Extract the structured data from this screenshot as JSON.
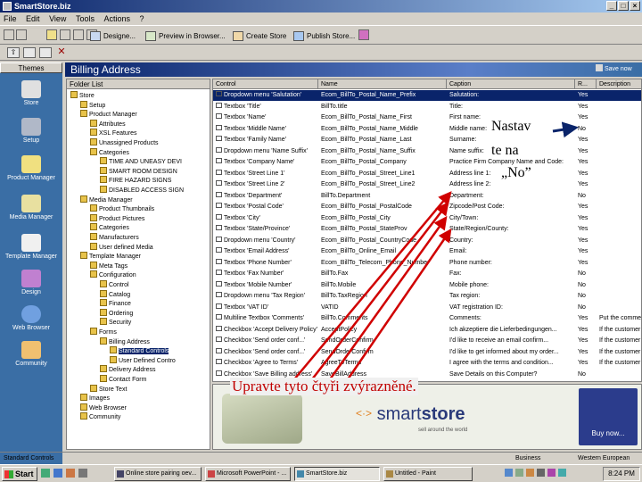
{
  "window": {
    "title": "SmartStore.biz"
  },
  "menu": [
    "File",
    "Edit",
    "View",
    "Tools",
    "Actions",
    "?"
  ],
  "toolbar": {
    "items": [
      "Designe...",
      "Preview in Browser...",
      "Create Store",
      "Publish Store..."
    ]
  },
  "themes": {
    "header": "Themes",
    "items": [
      "Store",
      "Setup",
      "Product Manager",
      "Media Manager",
      "Template Manager",
      "Design",
      "Web Browser",
      "Community"
    ]
  },
  "main": {
    "title": "Billing Address",
    "save_label": "Save now"
  },
  "folder": {
    "header": "Folder List",
    "items": [
      {
        "label": "Store",
        "level": 0
      },
      {
        "label": "Setup",
        "level": 1
      },
      {
        "label": "Product Manager",
        "level": 1
      },
      {
        "label": "Attributes",
        "level": 2
      },
      {
        "label": "XSL Features",
        "level": 2
      },
      {
        "label": "Unassigned Products",
        "level": 2
      },
      {
        "label": "Categories",
        "level": 2
      },
      {
        "label": "TIME AND UNEASY DEVI",
        "level": 3
      },
      {
        "label": "SMART ROOM DESIGN",
        "level": 3
      },
      {
        "label": "FIRE HAZARD SIGNS",
        "level": 3
      },
      {
        "label": "DISABLED ACCESS SIGN",
        "level": 3
      },
      {
        "label": "Media Manager",
        "level": 1
      },
      {
        "label": "Product Thumbnails",
        "level": 2
      },
      {
        "label": "Product Pictures",
        "level": 2
      },
      {
        "label": "Categories",
        "level": 2
      },
      {
        "label": "Manufacturers",
        "level": 2
      },
      {
        "label": "User defined Media",
        "level": 2
      },
      {
        "label": "Template Manager",
        "level": 1
      },
      {
        "label": "Meta Tags",
        "level": 2
      },
      {
        "label": "Configuration",
        "level": 2
      },
      {
        "label": "Control",
        "level": 3
      },
      {
        "label": "Catalog",
        "level": 3
      },
      {
        "label": "Finance",
        "level": 3
      },
      {
        "label": "Ordering",
        "level": 3
      },
      {
        "label": "Security",
        "level": 3
      },
      {
        "label": "Forms",
        "level": 2
      },
      {
        "label": "Billing Address",
        "level": 3
      },
      {
        "label": "Standard Controls",
        "level": 4,
        "selected": true
      },
      {
        "label": "User Defined Contro",
        "level": 4
      },
      {
        "label": "Delivery Address",
        "level": 3
      },
      {
        "label": "Contact Form",
        "level": 3
      },
      {
        "label": "Store Text",
        "level": 2
      },
      {
        "label": "Images",
        "level": 1
      },
      {
        "label": "Web Browser",
        "level": 1
      },
      {
        "label": "Community",
        "level": 1
      }
    ]
  },
  "grid": {
    "columns": [
      "Control",
      "Name",
      "Caption",
      "R...",
      "Description"
    ],
    "rows": [
      [
        "Dropdown menu 'Salutation'",
        "Ecom_BillTo_Postal_Name_Prefix",
        "Salutation:",
        "Yes",
        ""
      ],
      [
        "Textbox 'Title'",
        "BillTo.title",
        "Title:",
        "Yes",
        ""
      ],
      [
        "Textbox 'Name'",
        "Ecom_BillTo_Postal_Name_First",
        "First name:",
        "Yes",
        ""
      ],
      [
        "Textbox 'Middle Name'",
        "Ecom_BillTo_Postal_Name_Middle",
        "Middle name:",
        "No",
        ""
      ],
      [
        "Textbox 'Family Name'",
        "Ecom_BillTo_Postal_Name_Last",
        "Surname:",
        "Yes",
        ""
      ],
      [
        "Dropdown menu 'Name Suffix'",
        "Ecom_BillTo_Postal_Name_Suffix",
        "Name suffix:",
        "Yes",
        ""
      ],
      [
        "Textbox 'Company Name'",
        "Ecom_BillTo_Postal_Company",
        "Practice Firm Company Name and Code:",
        "Yes",
        ""
      ],
      [
        "Textbox 'Street Line 1'",
        "Ecom_BillTo_Postal_Street_Line1",
        "Address line 1:",
        "Yes",
        ""
      ],
      [
        "Textbox 'Street Line 2'",
        "Ecom_BillTo_Postal_Street_Line2",
        "Address line 2:",
        "Yes",
        ""
      ],
      [
        "Textbox 'Department'",
        "BillTo.Department",
        "Department:",
        "No",
        ""
      ],
      [
        "Textbox 'Postal Code'",
        "Ecom_BillTo_Postal_PostalCode",
        "Zipcode/Post Code:",
        "Yes",
        ""
      ],
      [
        "Textbox 'City'",
        "Ecom_BillTo_Postal_City",
        "City/Town:",
        "Yes",
        ""
      ],
      [
        "Textbox 'State/Province'",
        "Ecom_BillTo_Postal_StateProv",
        "State/Region/County:",
        "Yes",
        ""
      ],
      [
        "Dropdown menu 'Country'",
        "Ecom_BillTo_Postal_CountryCode",
        "Country:",
        "Yes",
        ""
      ],
      [
        "Textbox 'Email Address'",
        "Ecom_BillTo_Online_Email",
        "Email:",
        "Yes",
        ""
      ],
      [
        "Textbox 'Phone Number'",
        "Ecom_BillTo_Telecom_Phone_Number",
        "Phone number:",
        "Yes",
        ""
      ],
      [
        "Textbox 'Fax Number'",
        "BillTo.Fax",
        "Fax:",
        "No",
        ""
      ],
      [
        "Textbox 'Mobile Number'",
        "BillTo.Mobile",
        "Mobile phone:",
        "No",
        ""
      ],
      [
        "Dropdown menu 'Tax Region'",
        "BillTo.TaxRegion",
        "Tax region:",
        "No",
        ""
      ],
      [
        "Textbox 'VAT ID'",
        "VATID",
        "VAT registration ID:",
        "No",
        ""
      ],
      [
        "Multiline Textbox 'Comments'",
        "BillTo.Comments",
        "Comments:",
        "Yes",
        "Put the comment"
      ],
      [
        "Checkbox 'Accept Delivery Policy'",
        "AcceptPolicy",
        "Ich akzeptiere die Lieferbedingungen...",
        "Yes",
        "If the customer"
      ],
      [
        "Checkbox 'Send order conf...'",
        "SendOrderConfirm",
        "I'd like to receive an email confirm...",
        "Yes",
        "If the customer"
      ],
      [
        "Checkbox 'Send order conf...'",
        "SendOrderConfirm",
        "I'd like to get informed about my order...",
        "Yes",
        "If the customer"
      ],
      [
        "Checkbox 'Agree to Terms'",
        "AgreeToTerms",
        "I agree with the terms and condition...",
        "Yes",
        "If the customer"
      ],
      [
        "Checkbox 'Save Billing address'",
        "SaveBillAddress",
        "Save Details on this Computer?",
        "No",
        ""
      ]
    ]
  },
  "banner": {
    "brand_light": "smart",
    "brand_bold": "store",
    "tagline": "sell around the world",
    "buy_now": "Buy now..."
  },
  "status": {
    "left": "Standard Controls",
    "right1": "Business",
    "right2": "Western European"
  },
  "taskbar": {
    "start": "Start",
    "tasks": [
      "Online store pairing oev...",
      "Microsoft PowerPoint - ...",
      "SmartStore.biz",
      "Untitled - Paint"
    ],
    "clock": "8:24 PM"
  },
  "annotations": {
    "nastav": "Nastav",
    "tena": "te na",
    "no": "„No”",
    "bottom": "Upravte tyto čtyři zvýrazněné."
  },
  "colors": {
    "titlebar": "#0a246a",
    "annotation_red": "#d00000",
    "selection": "#0a246a"
  }
}
